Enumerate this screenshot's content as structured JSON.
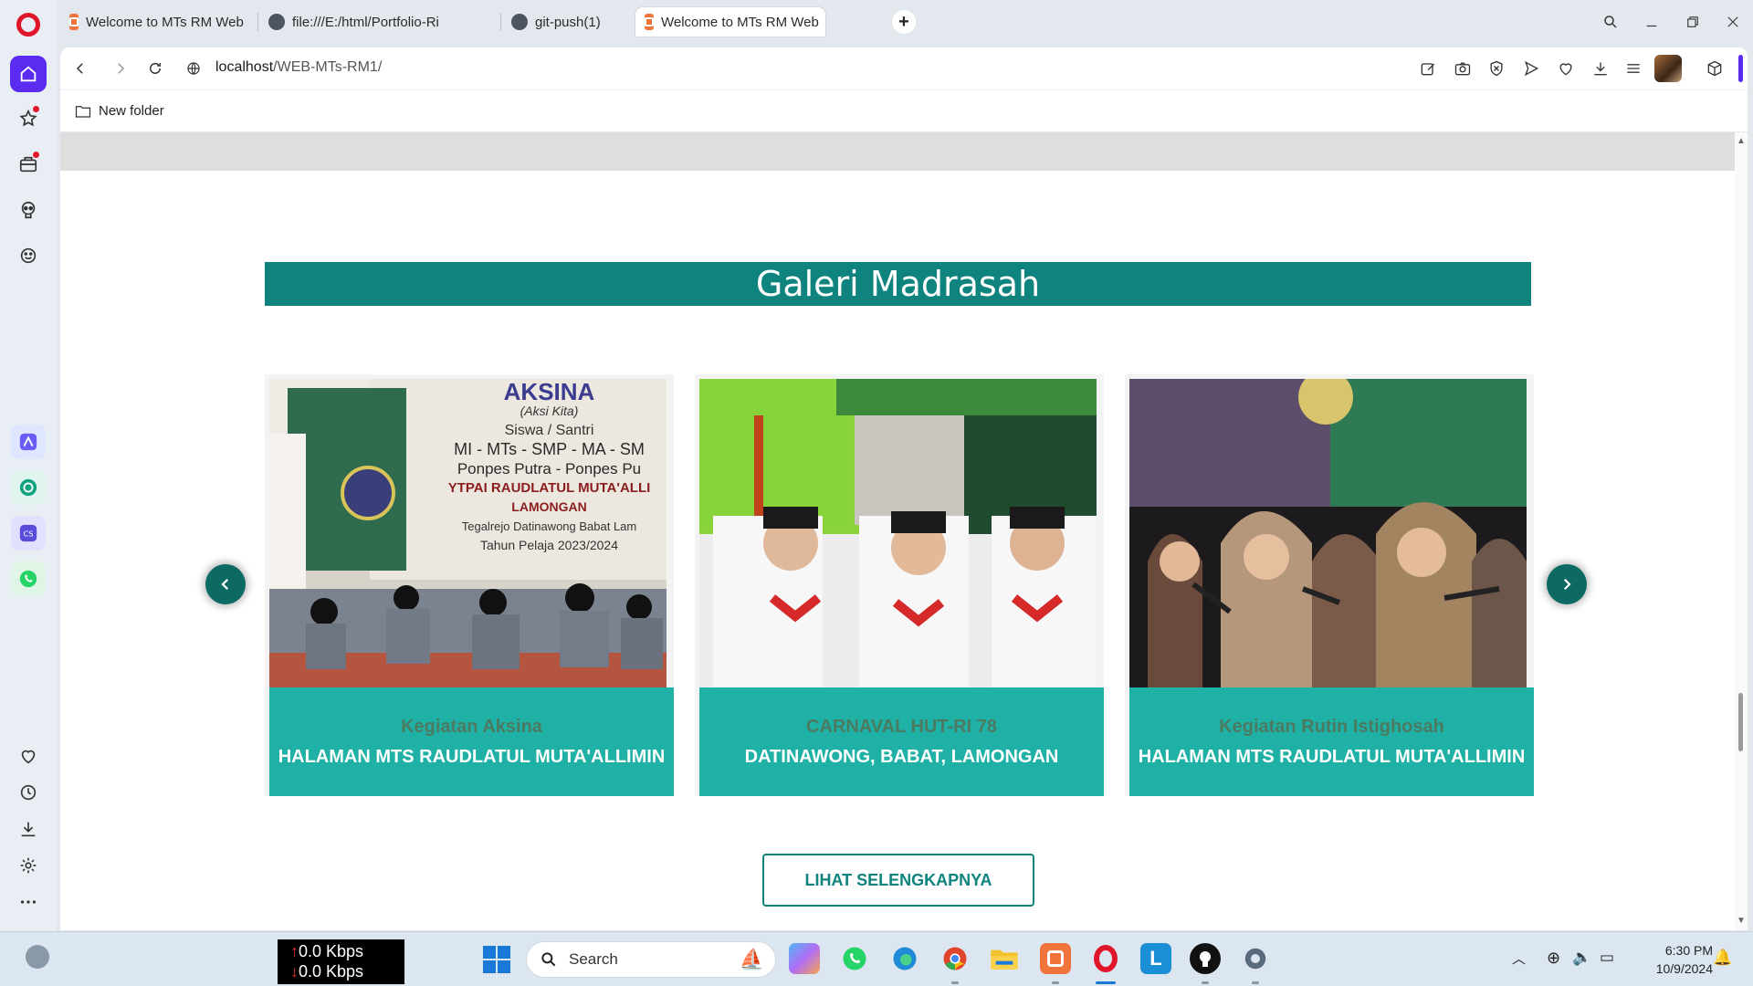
{
  "browser": {
    "tabs": [
      {
        "label": "Welcome to MTs RM Web",
        "icon": "xampp-icon",
        "active": false
      },
      {
        "label": "file:///E:/html/Portfolio-Ri",
        "icon": "globe-icon",
        "active": false
      },
      {
        "label": "git-push(1)",
        "icon": "globe-icon",
        "active": false
      },
      {
        "label": "Welcome to MTs RM Web",
        "icon": "xampp-icon",
        "active": true
      }
    ],
    "new_tab": "+",
    "url_host": "localhost",
    "url_path": "/WEB-MTs-RM1/",
    "bookmark": "New folder",
    "accent": "#5b2bf1"
  },
  "page": {
    "gallery_title": "Galeri Madrasah",
    "cards": [
      {
        "title": "Kegiatan Aksina",
        "location": "HALAMAN MTS RAUDLATUL MUTA'ALLIMIN",
        "banner_lines": [
          "AKSINA",
          "(Aksi Kita)",
          "Siswa / Santri",
          "MI - MTs - SMP - MA - SM",
          "Ponpes Putra - Ponpes Pu",
          "YTPAI RAUDLATUL MUTA'ALLI",
          "LAMONGAN",
          "Tegalrejo Datinawong Babat Lam",
          "Tahun Pelaja 2023/2024"
        ]
      },
      {
        "title": "CARNAVAL HUT-RI 78",
        "location": "DATINAWONG, BABAT, LAMONGAN"
      },
      {
        "title": "Kegiatan Rutin Istighosah",
        "location": "HALAMAN MTS RAUDLATUL MUTA'ALLIMIN"
      }
    ],
    "more_button": "LIHAT SELENGKAPNYA",
    "teal": "#0f837d",
    "caption_bg": "#1fb1a6"
  },
  "taskbar": {
    "net_up": "0.0 Kbps",
    "net_down": "0.0 Kbps",
    "search_label": "Search",
    "time": "6:30 PM",
    "date": "10/9/2024"
  }
}
